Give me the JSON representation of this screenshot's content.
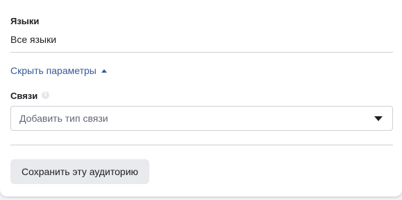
{
  "languages": {
    "label": "Языки",
    "value": "Все языки"
  },
  "advanced": {
    "toggle_label": "Скрыть параметры"
  },
  "connections": {
    "label": "Связи",
    "info_icon": "info-icon",
    "placeholder": "Добавить тип связи"
  },
  "actions": {
    "save_label": "Сохранить эту аудиторию"
  },
  "colors": {
    "link": "#385898",
    "text": "#1c1e21",
    "divider": "#ccd0d5",
    "button_bg": "#e9eaed"
  }
}
